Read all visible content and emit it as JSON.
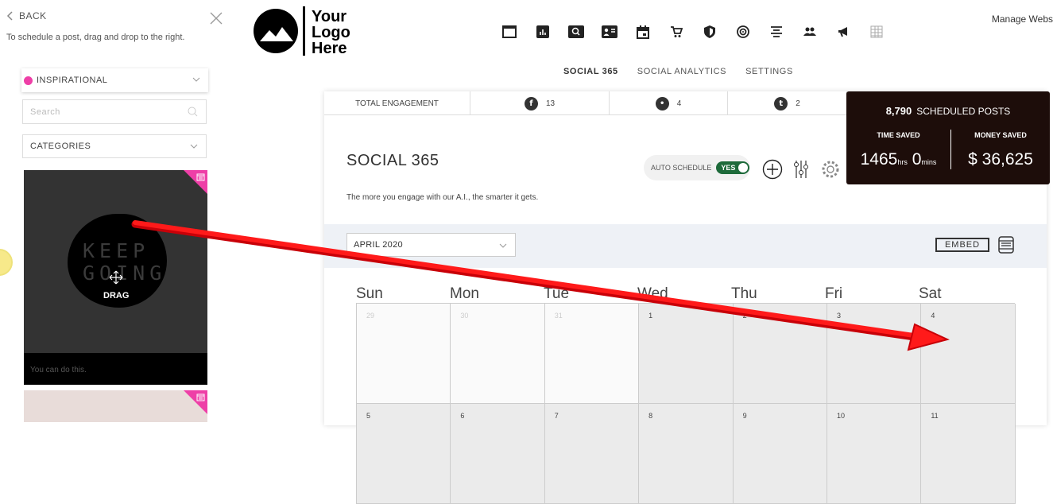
{
  "sidebar": {
    "back_label": "BACK",
    "hint": "To schedule a post, drag and drop to the right.",
    "category_selected": "INSPIRATIONAL",
    "search_placeholder": "Search",
    "categories_label": "CATEGORIES",
    "card1": {
      "overlay_text": "KEEP GOING",
      "drag_label": "DRAG",
      "caption": "You can do this."
    }
  },
  "header": {
    "logo_text": [
      "Your",
      "Logo",
      "Here"
    ],
    "manage_link": "Manage Webs",
    "nav_icons": [
      "window-icon",
      "bar-chart-icon",
      "search-box-icon",
      "contact-card-icon",
      "calendar-icon",
      "cart-icon",
      "shield-icon",
      "target-icon",
      "align-icon",
      "people-icon",
      "megaphone-icon",
      "building-icon"
    ],
    "tabs": [
      "SOCIAL 365",
      "SOCIAL ANALYTICS",
      "SETTINGS"
    ]
  },
  "stats": {
    "total_label": "TOTAL ENGAGEMENT",
    "facebook": "13",
    "twitter": "4",
    "tumblr": "2"
  },
  "main": {
    "title": "SOCIAL 365",
    "subtitle": "The more you engage with our A.I., the smarter it gets.",
    "auto_schedule_label": "AUTO SCHEDULE",
    "auto_schedule_value": "YES",
    "month": "APRIL 2020",
    "embed_label": "EMBED"
  },
  "calendar": {
    "days": [
      "Sun",
      "Mon",
      "Tue",
      "Wed",
      "Thu",
      "Fri",
      "Sat"
    ],
    "week1": [
      "29",
      "30",
      "31",
      "1",
      "2",
      "3",
      "4"
    ],
    "week2": [
      "5",
      "6",
      "7",
      "8",
      "9",
      "10",
      "11"
    ]
  },
  "summary": {
    "scheduled_count": "8,790",
    "scheduled_label": "SCHEDULED POSTS",
    "time_saved_label": "TIME SAVED",
    "money_saved_label": "MONEY SAVED",
    "time_hrs": "1465",
    "hrs_unit": "hrs",
    "time_mins": "0",
    "mins_unit": "mins",
    "money": "$ 36,625"
  },
  "colors": {
    "accent_pink": "#ee3fa7",
    "toggle_green": "#1d6a3a",
    "arrow_red": "#e8000b",
    "dark_box": "#1d0d0a"
  }
}
